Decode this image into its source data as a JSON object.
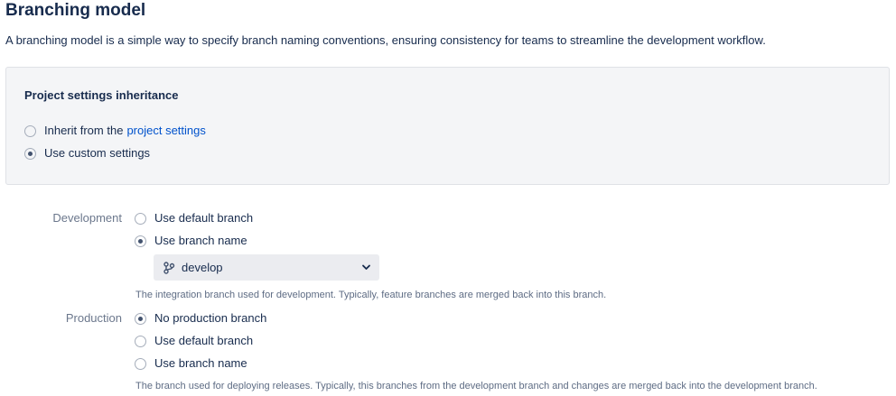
{
  "page": {
    "title": "Branching model",
    "description": "A branching model is a simple way to specify branch naming conventions, ensuring consistency for teams to streamline the development workflow."
  },
  "inheritance": {
    "title": "Project settings inheritance",
    "options": [
      {
        "label": "Inherit from the",
        "link": "project settings",
        "checked": false
      },
      {
        "label": "Use custom settings",
        "checked": true
      }
    ]
  },
  "development": {
    "label": "Development",
    "options": [
      {
        "label": "Use default branch",
        "checked": false
      },
      {
        "label": "Use branch name",
        "checked": true
      }
    ],
    "branch_select": {
      "value": "develop",
      "icon": "branch-icon"
    },
    "help": "The integration branch used for development. Typically, feature branches are merged back into this branch."
  },
  "production": {
    "label": "Production",
    "options": [
      {
        "label": "No production branch",
        "checked": true
      },
      {
        "label": "Use default branch",
        "checked": false
      },
      {
        "label": "Use branch name",
        "checked": false
      }
    ],
    "help": "The branch used for deploying releases. Typically, this branches from the development branch and changes are merged back into the development branch."
  }
}
